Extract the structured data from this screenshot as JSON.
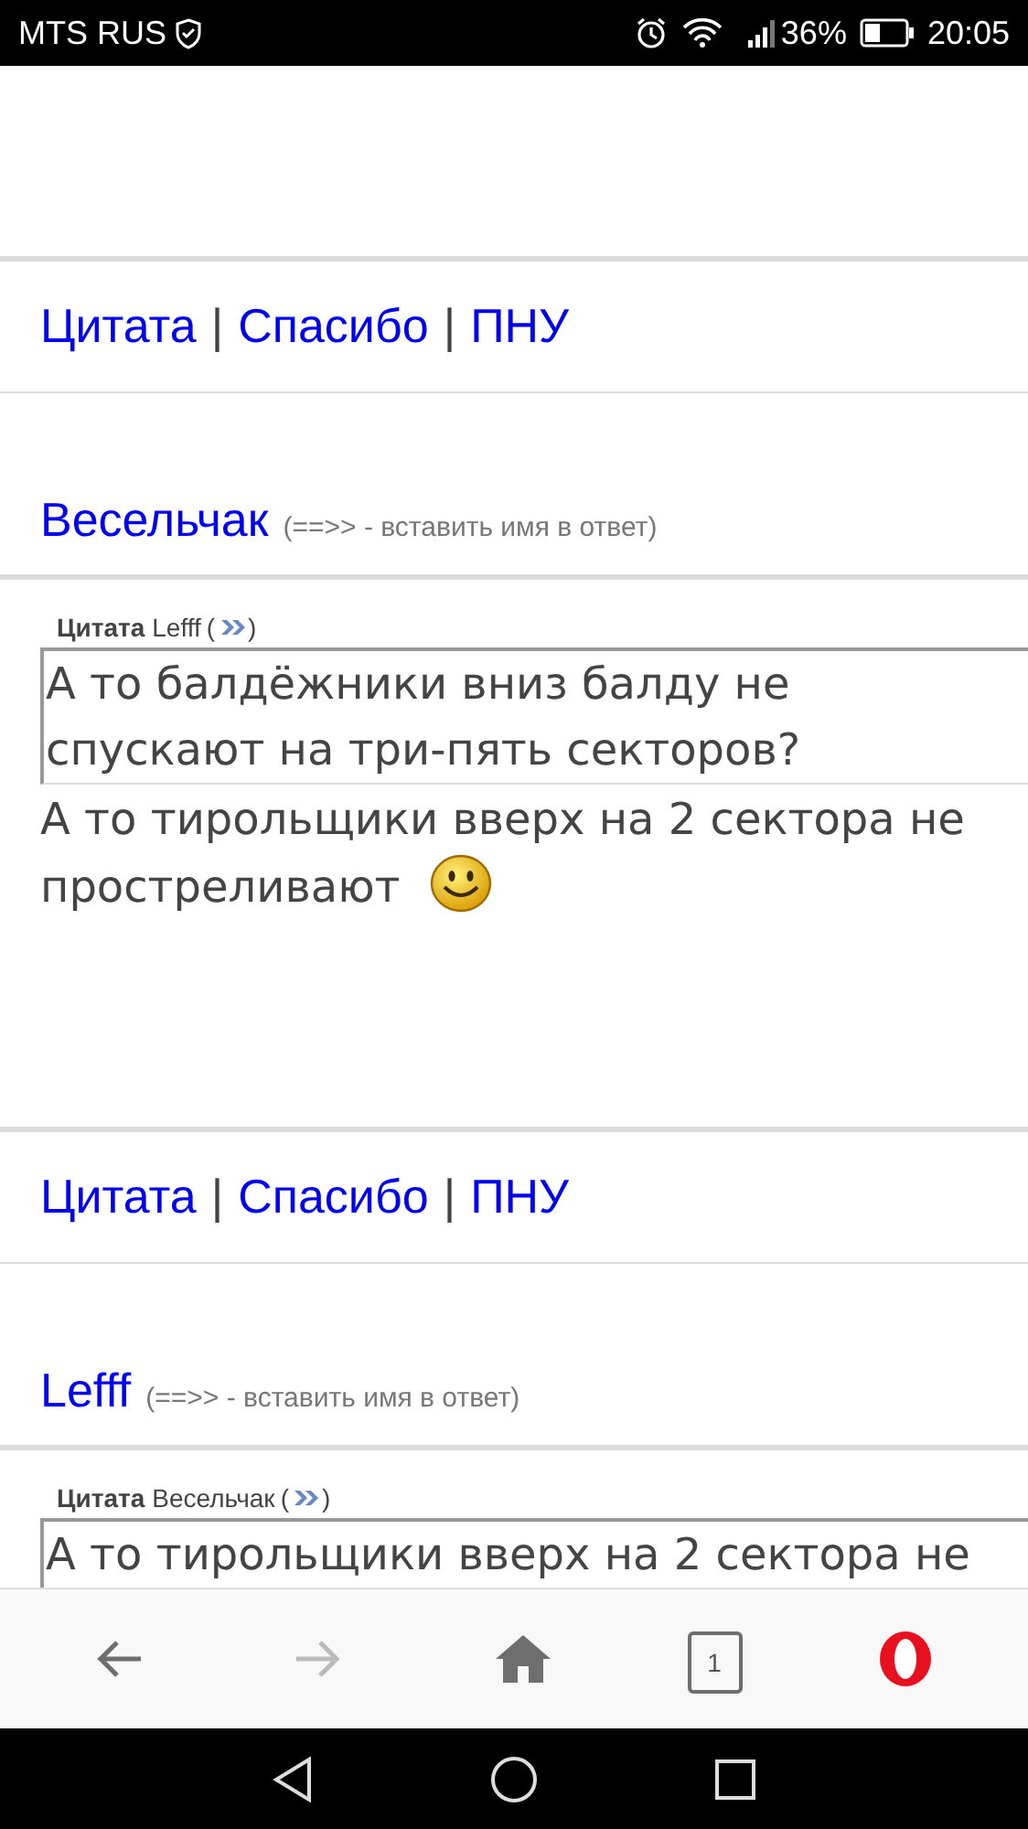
{
  "status_bar": {
    "carrier": "MTS RUS",
    "battery": "36%",
    "time": "20:05"
  },
  "blocks": [
    {
      "kind": "actions",
      "links": [
        {
          "kind": "link",
          "text": "Цитата"
        },
        {
          "kind": "sep",
          "text": "|"
        },
        {
          "kind": "link",
          "text": "Спасибо"
        },
        {
          "kind": "sep",
          "text": "|"
        },
        {
          "kind": "link",
          "text": "ПНУ"
        }
      ]
    },
    {
      "kind": "post",
      "author": "Весельчак",
      "hint": "(==>> - вставить имя в ответ)",
      "quote": {
        "label": "Цитата",
        "author": "Lefff",
        "open": "(",
        "close": ")",
        "text": "А то балдёжники вниз балду не спускают на три-пять секторов?"
      },
      "body": "А то тирольщики вверх на 2 сектора не простреливают"
    },
    {
      "kind": "actions",
      "links": [
        {
          "kind": "link",
          "text": "Цитата"
        },
        {
          "kind": "sep",
          "text": "|"
        },
        {
          "kind": "link",
          "text": "Спасибо"
        },
        {
          "kind": "sep",
          "text": "|"
        },
        {
          "kind": "link",
          "text": "ПНУ"
        }
      ]
    },
    {
      "kind": "post",
      "author": "Lefff",
      "hint": "(==>> - вставить имя в ответ)",
      "quote": {
        "label": "Цитата",
        "author": "Весельчак",
        "open": "(",
        "close": ")",
        "text": "А то тирольщики вверх на 2 сектора не"
      }
    }
  ],
  "toolbar": {
    "back_disabled": false,
    "forward_disabled": true,
    "tab_count": "1"
  }
}
